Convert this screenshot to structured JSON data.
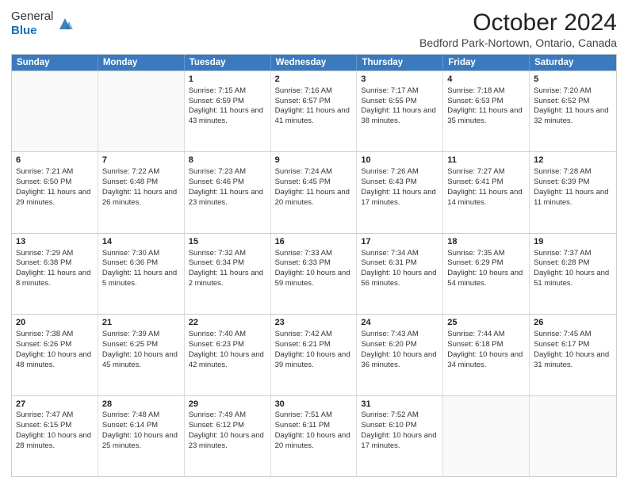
{
  "logo": {
    "general": "General",
    "blue": "Blue"
  },
  "title": "October 2024",
  "subtitle": "Bedford Park-Nortown, Ontario, Canada",
  "headers": [
    "Sunday",
    "Monday",
    "Tuesday",
    "Wednesday",
    "Thursday",
    "Friday",
    "Saturday"
  ],
  "weeks": [
    [
      {
        "day": "",
        "sunrise": "",
        "sunset": "",
        "daylight": "",
        "empty": true
      },
      {
        "day": "",
        "sunrise": "",
        "sunset": "",
        "daylight": "",
        "empty": true
      },
      {
        "day": "1",
        "sunrise": "Sunrise: 7:15 AM",
        "sunset": "Sunset: 6:59 PM",
        "daylight": "Daylight: 11 hours and 43 minutes."
      },
      {
        "day": "2",
        "sunrise": "Sunrise: 7:16 AM",
        "sunset": "Sunset: 6:57 PM",
        "daylight": "Daylight: 11 hours and 41 minutes."
      },
      {
        "day": "3",
        "sunrise": "Sunrise: 7:17 AM",
        "sunset": "Sunset: 6:55 PM",
        "daylight": "Daylight: 11 hours and 38 minutes."
      },
      {
        "day": "4",
        "sunrise": "Sunrise: 7:18 AM",
        "sunset": "Sunset: 6:53 PM",
        "daylight": "Daylight: 11 hours and 35 minutes."
      },
      {
        "day": "5",
        "sunrise": "Sunrise: 7:20 AM",
        "sunset": "Sunset: 6:52 PM",
        "daylight": "Daylight: 11 hours and 32 minutes."
      }
    ],
    [
      {
        "day": "6",
        "sunrise": "Sunrise: 7:21 AM",
        "sunset": "Sunset: 6:50 PM",
        "daylight": "Daylight: 11 hours and 29 minutes."
      },
      {
        "day": "7",
        "sunrise": "Sunrise: 7:22 AM",
        "sunset": "Sunset: 6:48 PM",
        "daylight": "Daylight: 11 hours and 26 minutes."
      },
      {
        "day": "8",
        "sunrise": "Sunrise: 7:23 AM",
        "sunset": "Sunset: 6:46 PM",
        "daylight": "Daylight: 11 hours and 23 minutes."
      },
      {
        "day": "9",
        "sunrise": "Sunrise: 7:24 AM",
        "sunset": "Sunset: 6:45 PM",
        "daylight": "Daylight: 11 hours and 20 minutes."
      },
      {
        "day": "10",
        "sunrise": "Sunrise: 7:26 AM",
        "sunset": "Sunset: 6:43 PM",
        "daylight": "Daylight: 11 hours and 17 minutes."
      },
      {
        "day": "11",
        "sunrise": "Sunrise: 7:27 AM",
        "sunset": "Sunset: 6:41 PM",
        "daylight": "Daylight: 11 hours and 14 minutes."
      },
      {
        "day": "12",
        "sunrise": "Sunrise: 7:28 AM",
        "sunset": "Sunset: 6:39 PM",
        "daylight": "Daylight: 11 hours and 11 minutes."
      }
    ],
    [
      {
        "day": "13",
        "sunrise": "Sunrise: 7:29 AM",
        "sunset": "Sunset: 6:38 PM",
        "daylight": "Daylight: 11 hours and 8 minutes."
      },
      {
        "day": "14",
        "sunrise": "Sunrise: 7:30 AM",
        "sunset": "Sunset: 6:36 PM",
        "daylight": "Daylight: 11 hours and 5 minutes."
      },
      {
        "day": "15",
        "sunrise": "Sunrise: 7:32 AM",
        "sunset": "Sunset: 6:34 PM",
        "daylight": "Daylight: 11 hours and 2 minutes."
      },
      {
        "day": "16",
        "sunrise": "Sunrise: 7:33 AM",
        "sunset": "Sunset: 6:33 PM",
        "daylight": "Daylight: 10 hours and 59 minutes."
      },
      {
        "day": "17",
        "sunrise": "Sunrise: 7:34 AM",
        "sunset": "Sunset: 6:31 PM",
        "daylight": "Daylight: 10 hours and 56 minutes."
      },
      {
        "day": "18",
        "sunrise": "Sunrise: 7:35 AM",
        "sunset": "Sunset: 6:29 PM",
        "daylight": "Daylight: 10 hours and 54 minutes."
      },
      {
        "day": "19",
        "sunrise": "Sunrise: 7:37 AM",
        "sunset": "Sunset: 6:28 PM",
        "daylight": "Daylight: 10 hours and 51 minutes."
      }
    ],
    [
      {
        "day": "20",
        "sunrise": "Sunrise: 7:38 AM",
        "sunset": "Sunset: 6:26 PM",
        "daylight": "Daylight: 10 hours and 48 minutes."
      },
      {
        "day": "21",
        "sunrise": "Sunrise: 7:39 AM",
        "sunset": "Sunset: 6:25 PM",
        "daylight": "Daylight: 10 hours and 45 minutes."
      },
      {
        "day": "22",
        "sunrise": "Sunrise: 7:40 AM",
        "sunset": "Sunset: 6:23 PM",
        "daylight": "Daylight: 10 hours and 42 minutes."
      },
      {
        "day": "23",
        "sunrise": "Sunrise: 7:42 AM",
        "sunset": "Sunset: 6:21 PM",
        "daylight": "Daylight: 10 hours and 39 minutes."
      },
      {
        "day": "24",
        "sunrise": "Sunrise: 7:43 AM",
        "sunset": "Sunset: 6:20 PM",
        "daylight": "Daylight: 10 hours and 36 minutes."
      },
      {
        "day": "25",
        "sunrise": "Sunrise: 7:44 AM",
        "sunset": "Sunset: 6:18 PM",
        "daylight": "Daylight: 10 hours and 34 minutes."
      },
      {
        "day": "26",
        "sunrise": "Sunrise: 7:45 AM",
        "sunset": "Sunset: 6:17 PM",
        "daylight": "Daylight: 10 hours and 31 minutes."
      }
    ],
    [
      {
        "day": "27",
        "sunrise": "Sunrise: 7:47 AM",
        "sunset": "Sunset: 6:15 PM",
        "daylight": "Daylight: 10 hours and 28 minutes."
      },
      {
        "day": "28",
        "sunrise": "Sunrise: 7:48 AM",
        "sunset": "Sunset: 6:14 PM",
        "daylight": "Daylight: 10 hours and 25 minutes."
      },
      {
        "day": "29",
        "sunrise": "Sunrise: 7:49 AM",
        "sunset": "Sunset: 6:12 PM",
        "daylight": "Daylight: 10 hours and 23 minutes."
      },
      {
        "day": "30",
        "sunrise": "Sunrise: 7:51 AM",
        "sunset": "Sunset: 6:11 PM",
        "daylight": "Daylight: 10 hours and 20 minutes."
      },
      {
        "day": "31",
        "sunrise": "Sunrise: 7:52 AM",
        "sunset": "Sunset: 6:10 PM",
        "daylight": "Daylight: 10 hours and 17 minutes."
      },
      {
        "day": "",
        "sunrise": "",
        "sunset": "",
        "daylight": "",
        "empty": true
      },
      {
        "day": "",
        "sunrise": "",
        "sunset": "",
        "daylight": "",
        "empty": true
      }
    ]
  ]
}
